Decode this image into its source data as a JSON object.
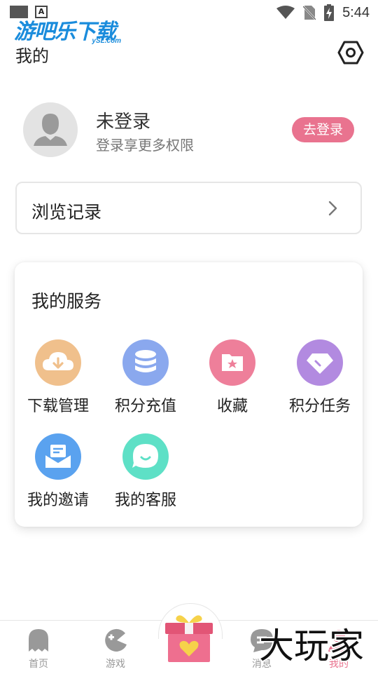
{
  "status_bar": {
    "time": "5:44"
  },
  "watermark": {
    "brand": "游吧乐下载",
    "domain": "ySL.com"
  },
  "header": {
    "title": "我的"
  },
  "profile": {
    "name": "未登录",
    "subtitle": "登录享更多权限",
    "login_label": "去登录"
  },
  "history": {
    "label": "浏览记录"
  },
  "services": {
    "title": "我的服务",
    "items": [
      {
        "label": "下载管理",
        "icon": "cloud-download-icon",
        "color": "#f0c08c"
      },
      {
        "label": "积分充值",
        "icon": "coin-stack-icon",
        "color": "#8aa8ee"
      },
      {
        "label": "收藏",
        "icon": "folder-star-icon",
        "color": "#ee7f9a"
      },
      {
        "label": "积分任务",
        "icon": "diamond-icon",
        "color": "#b28ae0"
      },
      {
        "label": "我的邀请",
        "icon": "envelope-icon",
        "color": "#5aa2ef"
      },
      {
        "label": "我的客服",
        "icon": "chat-bubble-icon",
        "color": "#5ee0c6"
      }
    ]
  },
  "bottom_nav": {
    "items": [
      {
        "label": "首页",
        "icon": "ghost-icon"
      },
      {
        "label": "游戏",
        "icon": "pacman-icon"
      },
      {
        "label": "消息",
        "icon": "message-icon"
      },
      {
        "label": "我的",
        "icon": "profile-icon",
        "active": true
      }
    ]
  },
  "corner_watermark": {
    "text": "大玩家"
  }
}
